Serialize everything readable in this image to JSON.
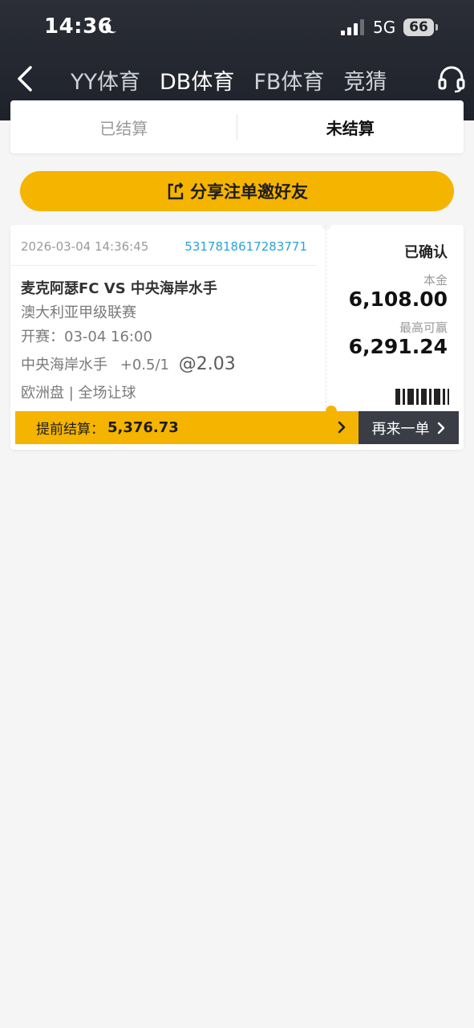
{
  "status_bar": {
    "time": "14:36",
    "network": "5G",
    "battery": "66"
  },
  "nav": {
    "tabs": [
      "YY体育",
      "DB体育",
      "FB体育",
      "竞猜"
    ],
    "active_tab": "DB体育"
  },
  "segments": {
    "settled": "已结算",
    "unsettled": "未结算",
    "active": "未结算"
  },
  "share_button": "分享注单邀好友",
  "bet": {
    "datetime": "2026-03-04 14:36:45",
    "order_id": "5317818617283771",
    "match": "麦克阿瑟FC VS 中央海岸水手",
    "league": "澳大利亚甲级联赛",
    "kickoff_label": "开赛",
    "kickoff_time": "开赛：03-04 16:00",
    "selection": "中央海岸水手",
    "handicap": "+0.5/1",
    "odds": "@2.03",
    "market": "欧洲盘 | 全场让球",
    "status": "已确认",
    "stake_label": "本金",
    "stake": "6,108.00",
    "max_win_label": "最高可赢",
    "max_win": "6,291.24",
    "cashout_label": "提前结算：",
    "cashout_value": "5,376.73",
    "rebet_label": "再来一单"
  },
  "colors": {
    "accent": "#f5b400",
    "header": "#23262e",
    "link": "#2aa3d8",
    "rebet_bg": "#3a3d46"
  }
}
